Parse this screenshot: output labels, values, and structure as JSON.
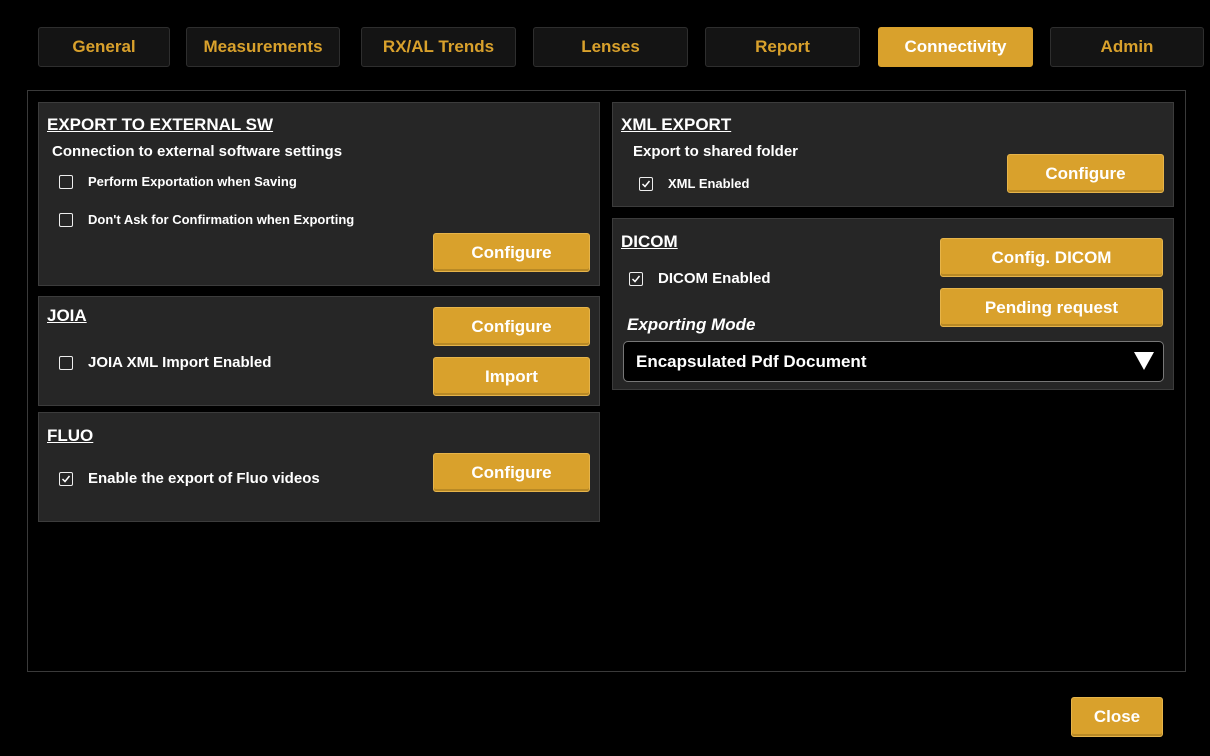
{
  "tabs": [
    {
      "label": "General",
      "active": false
    },
    {
      "label": "Measurements",
      "active": false
    },
    {
      "label": "RX/AL Trends",
      "active": false
    },
    {
      "label": "Lenses",
      "active": false
    },
    {
      "label": "Report",
      "active": false
    },
    {
      "label": "Connectivity",
      "active": true
    },
    {
      "label": "Admin",
      "active": false
    }
  ],
  "export_external": {
    "title": "EXPORT TO EXTERNAL SW",
    "subtitle": "Connection to external software settings",
    "options": [
      {
        "label": "Perform Exportation when Saving",
        "checked": false
      },
      {
        "label": "Don't Ask for Confirmation when Exporting",
        "checked": false
      }
    ],
    "configure_label": "Configure"
  },
  "joia": {
    "title": "JOIA",
    "option": {
      "label": "JOIA XML Import Enabled",
      "checked": false
    },
    "configure_label": "Configure",
    "import_label": "Import"
  },
  "fluo": {
    "title": "FLUO",
    "option": {
      "label": "Enable the export of Fluo videos",
      "checked": true
    },
    "configure_label": "Configure"
  },
  "xml_export": {
    "title": "XML EXPORT",
    "subtitle": "Export to shared folder",
    "option": {
      "label": "XML Enabled",
      "checked": true
    },
    "configure_label": "Configure"
  },
  "dicom": {
    "title": "DICOM",
    "option": {
      "label": "DICOM Enabled",
      "checked": true
    },
    "config_label": "Config. DICOM",
    "pending_label": "Pending request",
    "mode_label": "Exporting Mode",
    "mode_value": "Encapsulated Pdf Document"
  },
  "footer": {
    "close_label": "Close"
  },
  "colors": {
    "accent": "#d9a12c",
    "panel": "#262626",
    "background": "#000000"
  },
  "icons": {
    "checkbox": "checkbox-icon",
    "checked": "checkmark-icon",
    "dropdown": "triangle-down-icon"
  }
}
